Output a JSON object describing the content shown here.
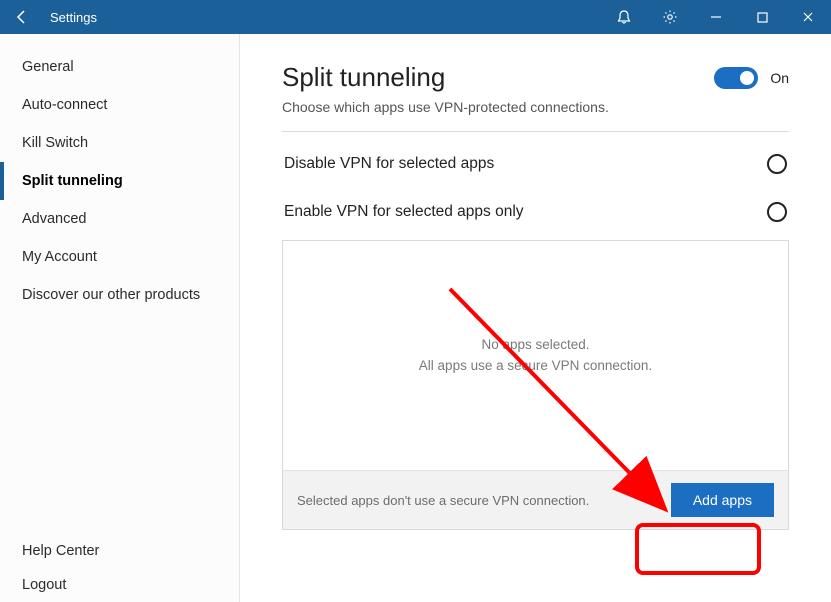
{
  "titlebar": {
    "title": "Settings"
  },
  "sidebar": {
    "items": [
      {
        "label": "General"
      },
      {
        "label": "Auto-connect"
      },
      {
        "label": "Kill Switch"
      },
      {
        "label": "Split tunneling"
      },
      {
        "label": "Advanced"
      },
      {
        "label": "My Account"
      },
      {
        "label": "Discover our other products"
      }
    ],
    "active_index": 3,
    "bottom": [
      {
        "label": "Help Center"
      },
      {
        "label": "Logout"
      }
    ]
  },
  "page": {
    "title": "Split tunneling",
    "subtitle": "Choose which apps use VPN-protected connections.",
    "toggle_on": true,
    "toggle_label": "On",
    "options": [
      {
        "label": "Disable VPN for selected apps"
      },
      {
        "label": "Enable VPN for selected apps only"
      }
    ],
    "empty": {
      "line1": "No apps selected.",
      "line2": "All apps use a secure VPN connection."
    },
    "footer_msg": "Selected apps don't use a secure VPN connection.",
    "add_button": "Add apps"
  }
}
